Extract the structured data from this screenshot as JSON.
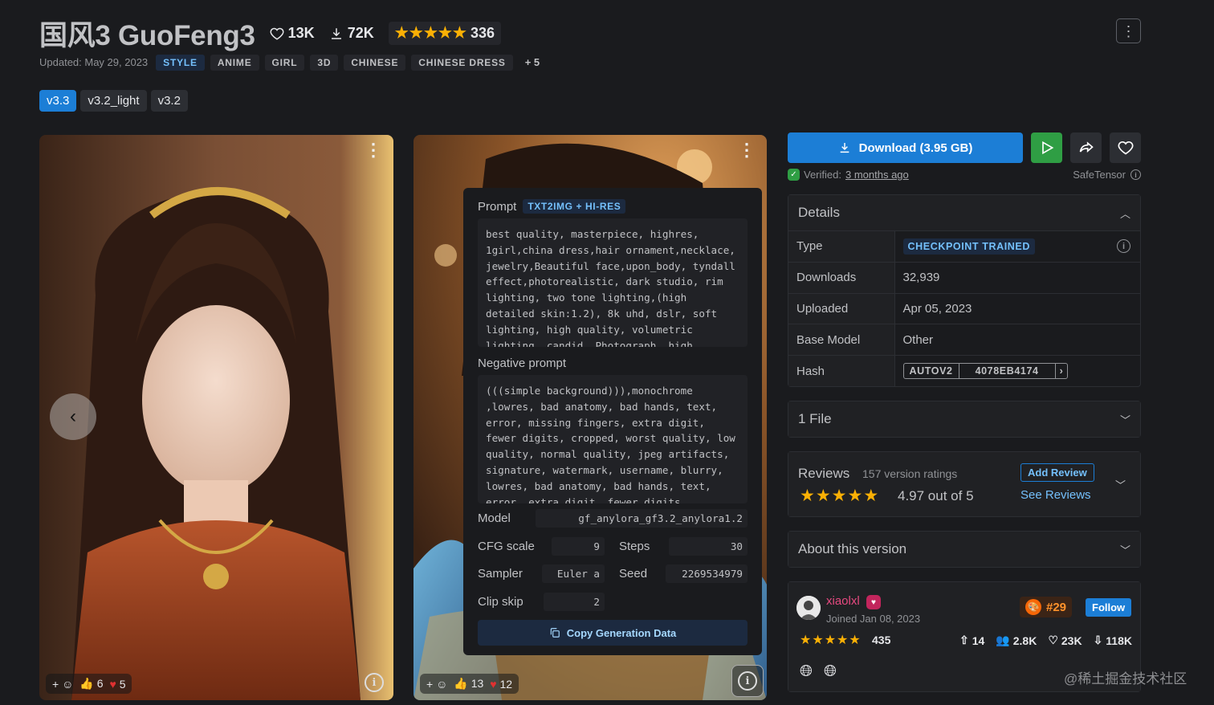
{
  "model": {
    "title": "国风3 GuoFeng3",
    "favorites": "13K",
    "downloads": "72K",
    "rating_count": "336",
    "updated": "Updated: May 29, 2023",
    "tags": [
      "STYLE",
      "ANIME",
      "GIRL",
      "3D",
      "CHINESE",
      "CHINESE DRESS"
    ],
    "more_tags": "+ 5"
  },
  "versions": [
    "v3.3",
    "v3.2_light",
    "v3.2"
  ],
  "images": [
    {
      "reactions": {
        "likes": "6",
        "hearts": "5"
      }
    },
    {
      "reactions": {
        "likes": "13",
        "hearts": "12"
      }
    }
  ],
  "generation": {
    "prompt_label": "Prompt",
    "prompt_tag": "TXT2IMG + HI-RES",
    "prompt": "best quality, masterpiece, highres, 1girl,china dress,hair ornament,necklace, jewelry,Beautiful face,upon_body, tyndall effect,photorealistic, dark studio, rim lighting, two tone lighting,(high detailed skin:1.2), 8k uhd, dslr, soft lighting, high quality, volumetric lighting, candid, Photograph, high",
    "negative_label": "Negative prompt",
    "negative_prompt": "(((simple background))),monochrome ,lowres, bad anatomy, bad hands, text, error, missing fingers, extra digit, fewer digits, cropped, worst quality, low quality, normal quality, jpeg artifacts, signature, watermark, username, blurry, lowres, bad anatomy, bad hands, text, error, extra digit, fewer digits",
    "model_label": "Model",
    "model_value": "gf_anylora_gf3.2_anylora1.2",
    "cfg_label": "CFG scale",
    "cfg_value": "9",
    "steps_label": "Steps",
    "steps_value": "30",
    "sampler_label": "Sampler",
    "sampler_value": "Euler a",
    "seed_label": "Seed",
    "seed_value": "2269534979",
    "clip_label": "Clip skip",
    "clip_value": "2",
    "copy_label": "Copy Generation Data"
  },
  "download": {
    "label": "Download (3.95 GB)",
    "verified_prefix": "Verified:",
    "verified_time": "3 months ago",
    "format": "SafeTensor"
  },
  "details": {
    "heading": "Details",
    "type_label": "Type",
    "type_value": "CHECKPOINT TRAINED",
    "downloads_label": "Downloads",
    "downloads_value": "32,939",
    "uploaded_label": "Uploaded",
    "uploaded_value": "Apr 05, 2023",
    "base_label": "Base Model",
    "base_value": "Other",
    "hash_label": "Hash",
    "hash_algo": "AUTOV2",
    "hash_value": "4078EB4174"
  },
  "files": {
    "heading": "1 File"
  },
  "reviews": {
    "heading": "Reviews",
    "count": "157 version ratings",
    "score": "4.97 out of 5",
    "add": "Add Review",
    "see": "See Reviews"
  },
  "about": {
    "heading": "About this version"
  },
  "creator": {
    "name": "xiaolxl",
    "joined": "Joined Jan 08, 2023",
    "rank": "#29",
    "follow": "Follow",
    "rating_count": "435",
    "uploads": "14",
    "followers": "2.8K",
    "favorites": "23K",
    "downloads": "118K"
  },
  "watermark": "@稀土掘金技术社区",
  "colors": {
    "accent": "#1c7ed6",
    "star": "#fab005",
    "play": "#2f9e44",
    "bg": "#1a1b1e"
  }
}
